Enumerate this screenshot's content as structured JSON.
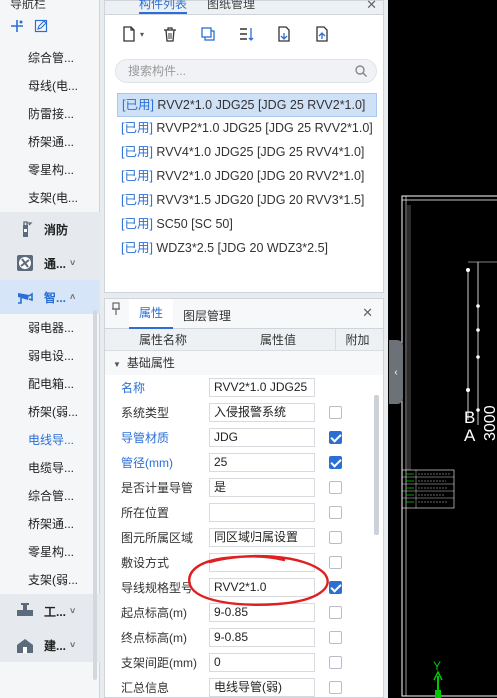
{
  "nav": {
    "title": "导航栏",
    "items_top": [
      "综合管...",
      "母线(电...",
      "防雷接...",
      "桥架通...",
      "零星构...",
      "支架(电..."
    ],
    "cats": [
      {
        "label": "消防",
        "icon": "fire-extinguisher-icon",
        "chev": ""
      },
      {
        "label": "通...",
        "icon": "ventilation-fan-icon",
        "chev": "˅"
      },
      {
        "label": "智...",
        "icon": "cctv-camera-icon",
        "chev": "˄"
      }
    ],
    "items_smart": [
      "弱电器...",
      "弱电设...",
      "配电箱...",
      "桥架(弱...",
      "电线导...",
      "电缆导...",
      "综合管...",
      "桥架通...",
      "零星构...",
      "支架(弱..."
    ],
    "active_item": "电线导...",
    "cats_bottom": [
      {
        "label": "工...",
        "icon": "pipe-valve-icon",
        "chev": "˅"
      },
      {
        "label": "建...",
        "icon": "building-icon",
        "chev": "˅"
      }
    ]
  },
  "comp": {
    "tab_active": "构件列表",
    "tab_other": "图纸管理",
    "search_placeholder": "搜索构件...",
    "items": [
      {
        "tag": "[已用]",
        "text": " RVV2*1.0 JDG25 [JDG 25 RVV2*1.0]"
      },
      {
        "tag": "[已用]",
        "text": " RVVP2*1.0 JDG25 [JDG 25 RVV2*1.0]"
      },
      {
        "tag": "[已用]",
        "text": " RVV4*1.0 JDG25 [JDG 25 RVV4*1.0]"
      },
      {
        "tag": "[已用]",
        "text": " RVV2*1.0 JDG20 [JDG 20 RVV2*1.0]"
      },
      {
        "tag": "[已用]",
        "text": " RVV3*1.5 JDG20 [JDG 20 RVV3*1.5]"
      },
      {
        "tag": "[已用]",
        "text": " SC50 [SC 50]"
      },
      {
        "tag": "[已用]",
        "text": " WDZ3*2.5 [JDG 20 WDZ3*2.5]"
      }
    ]
  },
  "prop": {
    "tab_active": "属性",
    "tab_other": "图层管理",
    "col_name": "属性名称",
    "col_value": "属性值",
    "col_add": "附加",
    "section": "基础属性",
    "rows": [
      {
        "name": "名称",
        "value": "RVV2*1.0 JDG25",
        "blue": true,
        "cb": "none"
      },
      {
        "name": "系统类型",
        "value": "入侵报警系统",
        "blue": false,
        "cb": "off"
      },
      {
        "name": "导管材质",
        "value": "JDG",
        "blue": true,
        "cb": "on"
      },
      {
        "name": "管径(mm)",
        "value": "25",
        "blue": true,
        "cb": "on"
      },
      {
        "name": "是否计量导管",
        "value": "是",
        "blue": false,
        "cb": "off"
      },
      {
        "name": "所在位置",
        "value": "",
        "blue": false,
        "cb": "off"
      },
      {
        "name": "图元所属区域",
        "value": "同区域归属设置",
        "blue": false,
        "cb": "off"
      },
      {
        "name": "敷设方式",
        "value": "",
        "blue": false,
        "cb": "off"
      },
      {
        "name": "导线规格型号",
        "value": "RVV2*1.0",
        "blue": false,
        "cb": "on"
      },
      {
        "name": "起点标高(m)",
        "value": "9-0.85",
        "blue": false,
        "cb": "off"
      },
      {
        "name": "终点标高(m)",
        "value": "9-0.85",
        "blue": false,
        "cb": "off"
      },
      {
        "name": "支架间距(mm)",
        "value": "0",
        "blue": false,
        "cb": "off"
      },
      {
        "name": "汇总信息",
        "value": "电线导管(弱)",
        "blue": false,
        "cb": "off"
      }
    ]
  },
  "canvas": {
    "label_b": "B",
    "label_a": "A",
    "dim_text": "3000",
    "axis_label": "Y"
  },
  "colors": {
    "accent": "#2a6fd6",
    "selected_row": "#cfe1f7",
    "markup_red": "#e02020",
    "cad_green": "#00c800",
    "cad_white": "#ffffff"
  }
}
